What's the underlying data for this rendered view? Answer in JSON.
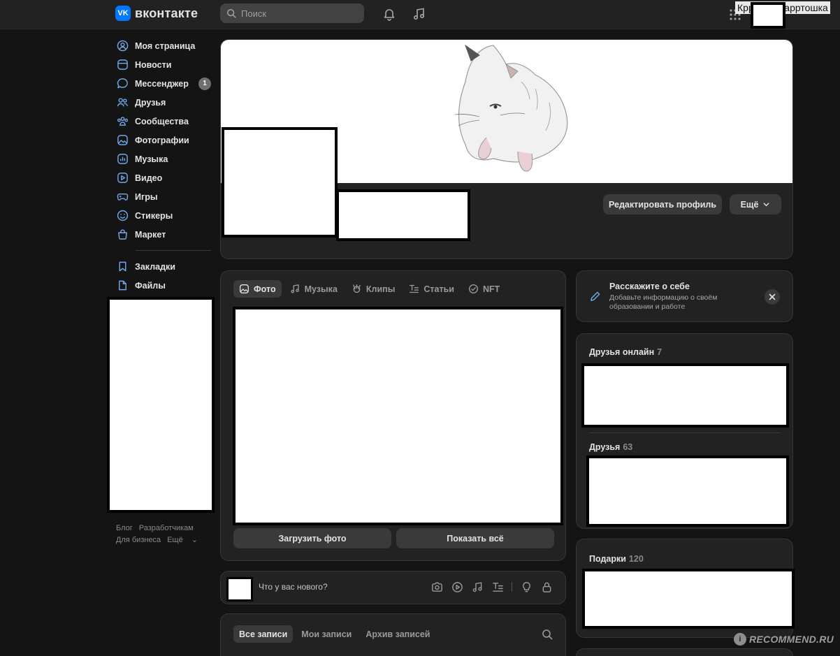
{
  "header": {
    "brand": "вконтакте",
    "brand_mark": "VK",
    "search_placeholder": "Поиск",
    "user_name": "Кррошка карртошка",
    "icons": [
      "bell-icon",
      "music-icon",
      "apps-grid-icon"
    ]
  },
  "sidebar": {
    "items": [
      {
        "label": "Моя страница",
        "icon": "user-circle-icon"
      },
      {
        "label": "Новости",
        "icon": "news-icon"
      },
      {
        "label": "Мессенджер",
        "icon": "message-icon",
        "badge": "1"
      },
      {
        "label": "Друзья",
        "icon": "friends-icon"
      },
      {
        "label": "Сообщества",
        "icon": "communities-icon"
      },
      {
        "label": "Фотографии",
        "icon": "photo-icon"
      },
      {
        "label": "Музыка",
        "icon": "music-bars-icon"
      },
      {
        "label": "Видео",
        "icon": "video-icon"
      },
      {
        "label": "Игры",
        "icon": "gamepad-icon"
      },
      {
        "label": "Стикеры",
        "icon": "smile-icon"
      },
      {
        "label": "Маркет",
        "icon": "bag-icon"
      }
    ],
    "secondary": [
      {
        "label": "Закладки",
        "icon": "bookmark-icon"
      },
      {
        "label": "Файлы",
        "icon": "file-icon"
      }
    ],
    "footer": [
      "Блог",
      "Разработчикам",
      "Для бизнеса",
      "Ещё"
    ]
  },
  "profile": {
    "edit_button": "Редактировать профиль",
    "more_button": "Ещё"
  },
  "media": {
    "tabs": [
      {
        "label": "Фото",
        "icon": "photo-icon",
        "active": true
      },
      {
        "label": "Музыка",
        "icon": "music-icon",
        "active": false
      },
      {
        "label": "Клипы",
        "icon": "clips-icon",
        "active": false
      },
      {
        "label": "Статьи",
        "icon": "article-icon",
        "active": false
      },
      {
        "label": "NFT",
        "icon": "nft-check-icon",
        "active": false
      }
    ],
    "upload_button": "Загрузить фото",
    "show_all_button": "Показать всё"
  },
  "composer": {
    "placeholder": "Что у вас нового?",
    "icons": [
      "camera-icon",
      "play-circle-icon",
      "music-icon",
      "article-icon",
      "lightbulb-icon",
      "lock-icon"
    ]
  },
  "wall": {
    "tabs": [
      {
        "label": "Все записи",
        "active": true
      },
      {
        "label": "Мои записи",
        "active": false
      },
      {
        "label": "Архив записей",
        "active": false
      }
    ]
  },
  "about": {
    "title": "Расскажите о себе",
    "subtitle": "Добавьте информацию о своём образовании и работе"
  },
  "friends": {
    "online_label": "Друзья онлайн",
    "online_count": "7",
    "all_label": "Друзья",
    "all_count": "63"
  },
  "gifts": {
    "label": "Подарки",
    "count": "120"
  },
  "watermark": {
    "text": "RECOMMEND.RU",
    "mark": "i"
  },
  "colors": {
    "background": "#141414",
    "card": "#222222",
    "accent": "#0077ff",
    "button": "#3a3a3a"
  }
}
